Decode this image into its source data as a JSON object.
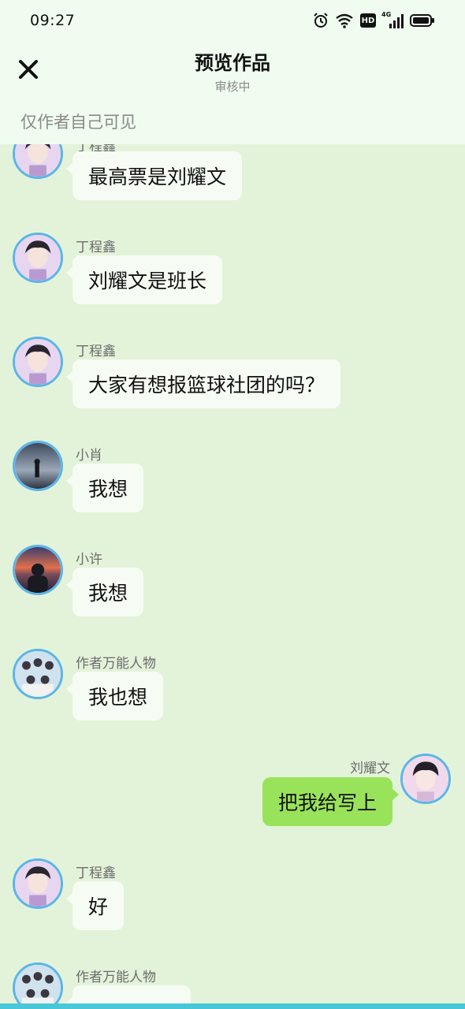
{
  "status_bar": {
    "time": "09:27",
    "icons": [
      "alarm-icon",
      "wifi-icon",
      "hd-icon",
      "4g-signal-icon",
      "battery-icon"
    ],
    "hd_label": "HD",
    "network_label": "4G"
  },
  "header": {
    "title": "预览作品",
    "subtitle": "审核中",
    "close_icon": "close-icon"
  },
  "visibility_note": "仅作者自己可见",
  "messages": [
    {
      "sender": "丁程鑫",
      "text": "最高票是刘耀文",
      "side": "left",
      "avatar": "dcx"
    },
    {
      "sender": "丁程鑫",
      "text": "刘耀文是班长",
      "side": "left",
      "avatar": "dcx"
    },
    {
      "sender": "丁程鑫",
      "text": "大家有想报篮球社团的吗？",
      "side": "left",
      "avatar": "dcx"
    },
    {
      "sender": "小肖",
      "text": "我想",
      "side": "left",
      "avatar": "xiaoxiao"
    },
    {
      "sender": "小许",
      "text": "我想",
      "side": "left",
      "avatar": "xiaoxu"
    },
    {
      "sender": "作者万能人物",
      "text": "我也想",
      "side": "left",
      "avatar": "group"
    },
    {
      "sender": "刘耀文",
      "text": "把我给写上",
      "side": "right",
      "avatar": "lyw"
    },
    {
      "sender": "丁程鑫",
      "text": "好",
      "side": "left",
      "avatar": "dcx"
    },
    {
      "sender": "作者万能人物",
      "text": "",
      "side": "left",
      "avatar": "group"
    }
  ],
  "colors": {
    "chat_background": "#e3f3da",
    "header_background": "#effcef",
    "left_bubble": "#f6fcf4",
    "right_bubble": "#99e35a",
    "avatar_ring": "#5bb5e8"
  }
}
